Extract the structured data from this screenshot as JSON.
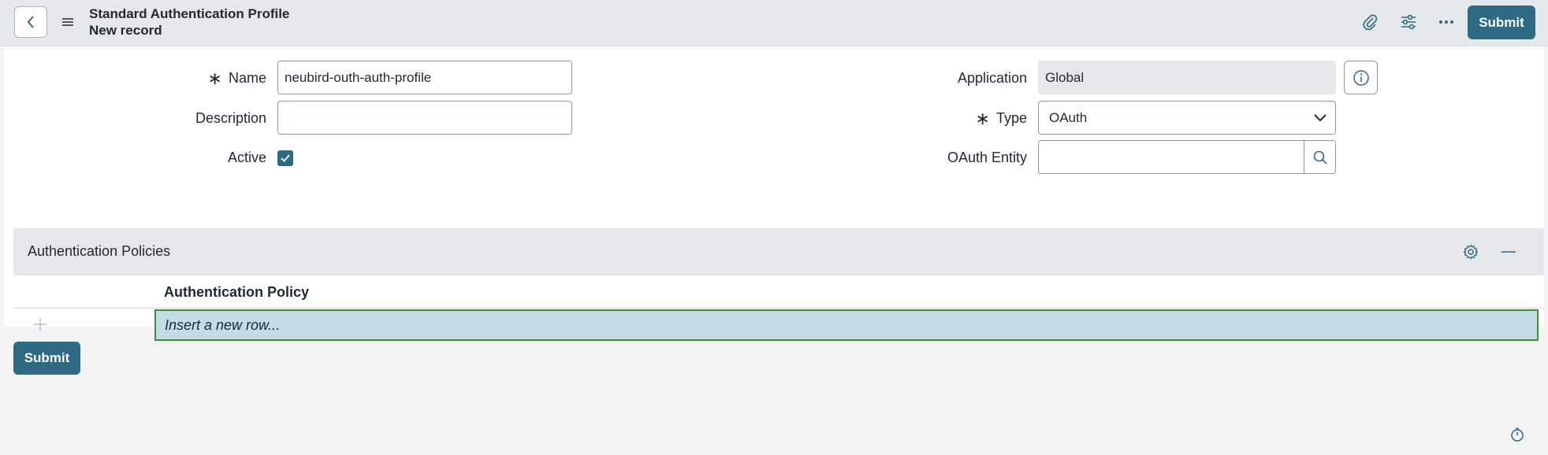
{
  "header": {
    "title": "Standard Authentication Profile",
    "subtitle": "New record",
    "submit_label": "Submit",
    "icons": [
      "back-icon",
      "hamburger-menu-icon",
      "paperclip-icon",
      "sliders-icon",
      "more-options-icon"
    ]
  },
  "form": {
    "name": {
      "label": "Name",
      "required": true,
      "value": "neubird-outh-auth-profile"
    },
    "description": {
      "label": "Description",
      "value": ""
    },
    "active": {
      "label": "Active",
      "checked": true
    },
    "application": {
      "label": "Application",
      "value": "Global"
    },
    "type": {
      "label": "Type",
      "required": true,
      "value": "OAuth"
    },
    "oauth_entity": {
      "label": "OAuth Entity",
      "value": ""
    }
  },
  "related_list": {
    "title": "Authentication Policies",
    "column": "Authentication Policy",
    "insert_placeholder": "Insert a new row..."
  },
  "footer": {
    "submit_label": "Submit"
  },
  "colors": {
    "accent": "#2e6a84",
    "header_bg": "#e4e8ea",
    "insert_row_bg": "#c4dce6",
    "insert_row_border": "#3e9032"
  }
}
